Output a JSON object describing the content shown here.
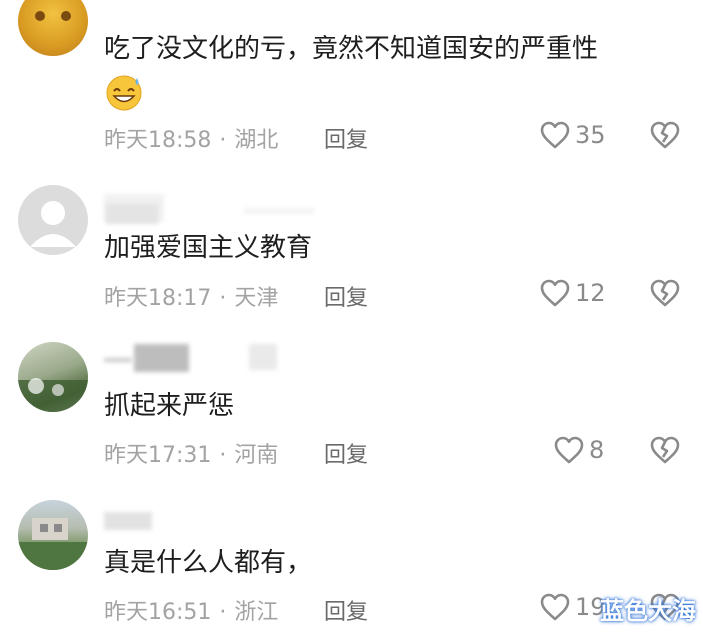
{
  "comments": [
    {
      "text": "吃了没文化的亏，竟然不知道国安的严重性",
      "time": "昨天18:58",
      "location": "湖北",
      "reply": "回复",
      "likes": "35",
      "has_emoji": true
    },
    {
      "text": "加强爱国主义教育",
      "time": "昨天18:17",
      "location": "天津",
      "reply": "回复",
      "likes": "12"
    },
    {
      "text": "抓起来严惩",
      "time": "昨天17:31",
      "location": "河南",
      "reply": "回复",
      "likes": "8"
    },
    {
      "text": "真是什么人都有，",
      "time": "昨天16:51",
      "location": "浙江",
      "reply": "回复",
      "likes": "19"
    }
  ],
  "separator": "·",
  "watermark": "蓝色大海",
  "colors": {
    "meta": "#a3a3a3",
    "icon": "#8a8a8a",
    "text": "#1e1e1e"
  }
}
